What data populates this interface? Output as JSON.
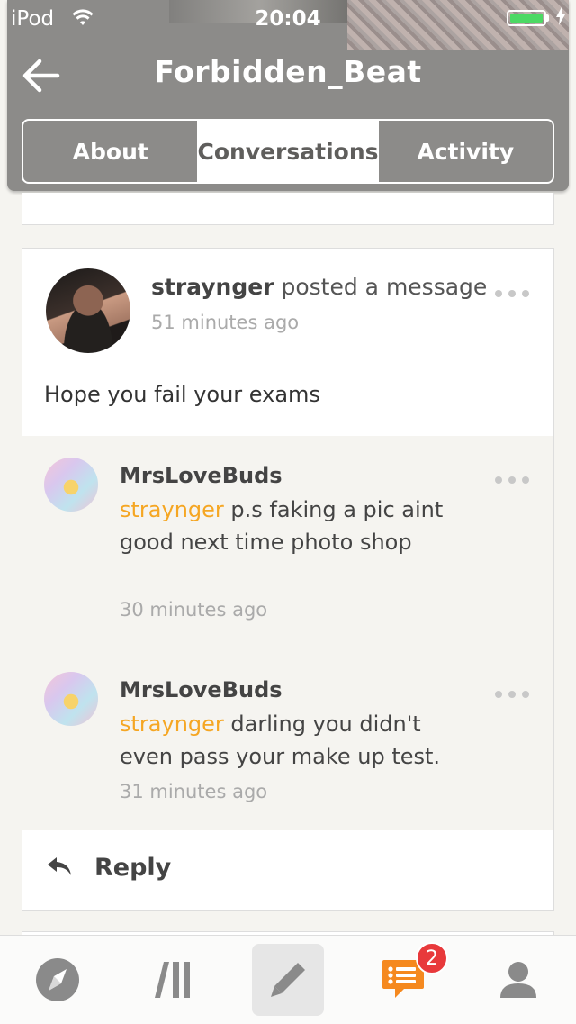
{
  "status_bar": {
    "carrier": "iPod",
    "time": "20:04"
  },
  "header": {
    "title": "Forbidden_Beat",
    "tabs": [
      {
        "label": "About",
        "active": false
      },
      {
        "label": "Conversations",
        "active": true
      },
      {
        "label": "Activity",
        "active": false
      }
    ]
  },
  "post": {
    "author": "straynger",
    "action": " posted a message",
    "time": "51 minutes ago",
    "body": "Hope you fail your exams"
  },
  "comments": [
    {
      "author": "MrsLoveBuds",
      "mention": "straynger",
      "text": " p.s faking a pic aint good next time photo shop",
      "time": "30 minutes ago"
    },
    {
      "author": "MrsLoveBuds",
      "mention": "straynger",
      "text": " darling you didn't even pass your make up test.",
      "time": "31 minutes ago"
    }
  ],
  "reply": {
    "label": "Reply"
  },
  "tabbar": {
    "items": [
      "compass-icon",
      "library-icon",
      "pencil-icon",
      "conversations-icon",
      "profile-icon"
    ],
    "badge": "2"
  },
  "colors": {
    "header_bg": "#8c8b89",
    "accent_orange": "#f5a623",
    "badge_red": "#e8393b",
    "battery_green": "#4cd964"
  }
}
